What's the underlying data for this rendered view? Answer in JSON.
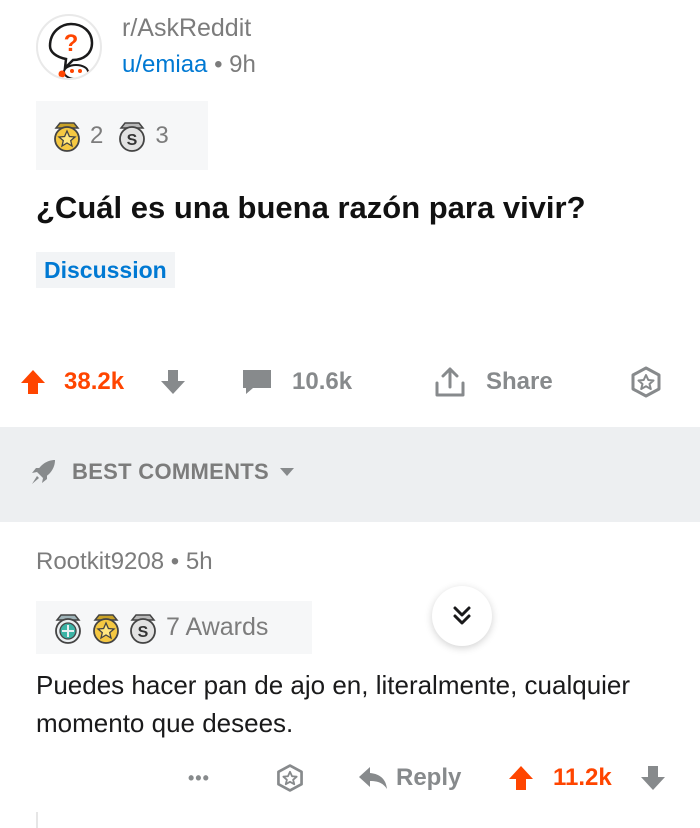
{
  "post": {
    "subreddit": "r/AskReddit",
    "author": "u/emiaa",
    "separator": "•",
    "time": "9h",
    "awards": [
      {
        "icon": "gold-award-icon",
        "count": "2"
      },
      {
        "icon": "silver-award-icon",
        "count": "3"
      }
    ],
    "title": "¿Cuál es una buena razón para vivir?",
    "flair": "Discussion",
    "actions": {
      "upvotes": "38.2k",
      "comments": "10.6k",
      "share": "Share"
    }
  },
  "sort": {
    "label": "BEST COMMENTS"
  },
  "comment": {
    "author": "Rootkit9208",
    "separator": "•",
    "time": "5h",
    "awards_label": "7 Awards",
    "body": "Puedes hacer pan de ajo en, literalmente, cualquier momento que desees.",
    "actions": {
      "more": "•••",
      "reply": "Reply",
      "upvotes": "11.2k"
    }
  },
  "colors": {
    "upvote": "#ff4500",
    "link_blue": "#0079d3",
    "muted": "#878a8c",
    "sort_bg": "#edeff1"
  }
}
